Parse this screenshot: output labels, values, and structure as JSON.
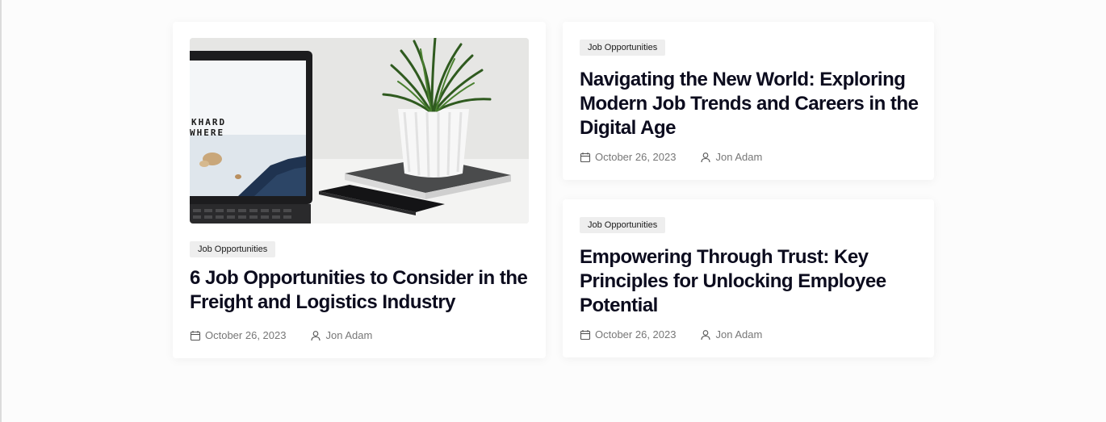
{
  "posts": [
    {
      "category": "Job Opportunities",
      "title": "6 Job Opportunities to Consider in the Freight and Logistics Industry",
      "date": "October 26, 2023",
      "author": "Jon Adam",
      "image": {
        "subject": "laptop-with-plant-and-phone-photo",
        "screen_text_line1": "KHARD",
        "screen_text_line2": "WHERE"
      }
    },
    {
      "category": "Job Opportunities",
      "title": "Navigating the New World: Exploring Modern Job Trends and Careers in the Digital Age",
      "date": "October 26, 2023",
      "author": "Jon Adam"
    },
    {
      "category": "Job Opportunities",
      "title": "Empowering Through Trust: Key Principles for Unlocking Employee Potential",
      "date": "October 26, 2023",
      "author": "Jon Adam"
    }
  ],
  "icons": {
    "date": "calendar-icon",
    "author": "user-icon"
  },
  "colors": {
    "title": "#0c0c1e",
    "meta": "#777777",
    "tag_bg": "#eeeeee",
    "card_bg": "#ffffff",
    "page_bg": "#fcfcfc"
  }
}
